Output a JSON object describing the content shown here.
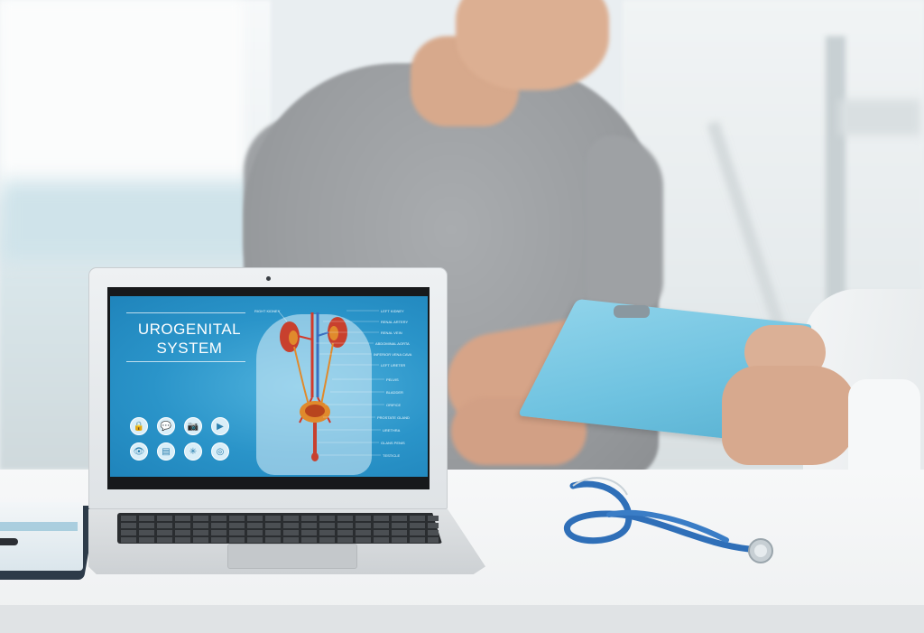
{
  "laptop_screen": {
    "title_line1": "UROGENITAL",
    "title_line2": "SYSTEM",
    "top_label": "RIGHT KIDNEY",
    "diagram_labels": [
      "LEFT KIDNEY",
      "RENAL ARTERY",
      "RENAL VEIN",
      "ABDOMINAL AORTA",
      "INFERIOR VENA CAVA",
      "LEFT URETER",
      "PELVIS",
      "BLADDER",
      "ORIFICE",
      "PROSTATE GLAND",
      "URETHRA",
      "GLANS PENIS",
      "TESTICLE"
    ],
    "icons": [
      "lock-icon",
      "chat-icon",
      "camera-icon",
      "video-icon",
      "eye-icon",
      "document-icon",
      "network-icon",
      "globe-icon"
    ],
    "icon_glyphs": [
      "🔒",
      "💬",
      "📷",
      "▶",
      "👁",
      "▤",
      "✳",
      "◎"
    ],
    "colors": {
      "screen_blue": "#2a94c9",
      "kidney_red": "#c8402e",
      "ureter_orange": "#e08a2c"
    }
  }
}
